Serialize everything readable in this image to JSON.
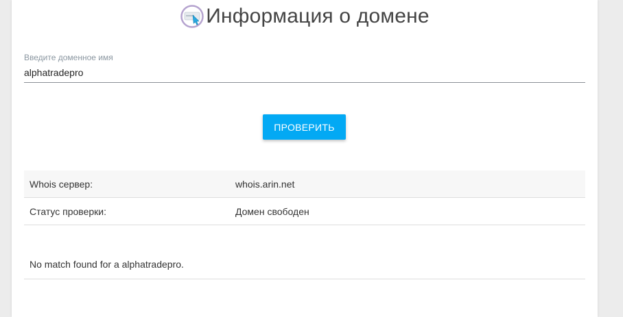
{
  "header": {
    "title": "Информация о домене",
    "icon": "domain-pointer-icon"
  },
  "search": {
    "label": "Введите доменное имя",
    "value": "alphatradepro",
    "placeholder": ""
  },
  "check_button": {
    "label": "ПРОВЕРИТЬ"
  },
  "info": {
    "rows": [
      {
        "key": "Whois сервер:",
        "value": "whois.arin.net"
      },
      {
        "key": "Статус проверки:",
        "value": "Домен свободен"
      }
    ]
  },
  "result": {
    "text": "No match found for a alphatradepro."
  },
  "colors": {
    "accent": "#03a9f4",
    "logo_ring": "#b5a3cf"
  }
}
